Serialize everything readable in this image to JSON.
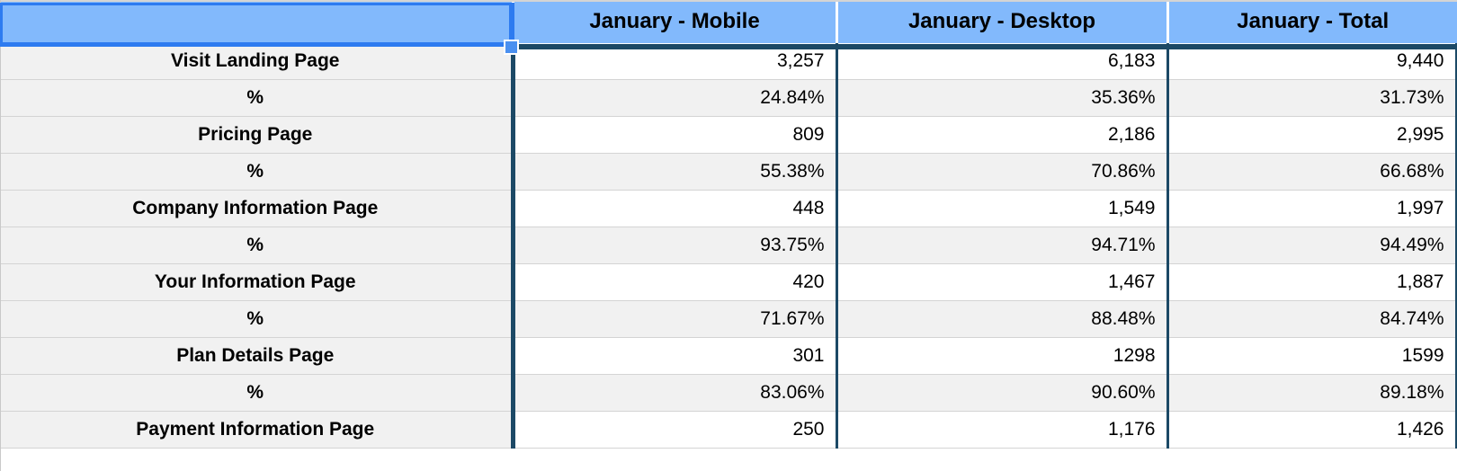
{
  "table": {
    "columns": [
      {
        "key": "label",
        "header": ""
      },
      {
        "key": "mobile",
        "header": "January - Mobile"
      },
      {
        "key": "desktop",
        "header": "January - Desktop"
      },
      {
        "key": "total",
        "header": "January - Total"
      }
    ],
    "rows": [
      {
        "label": "Visit Landing Page",
        "mobile": "3,257",
        "desktop": "6,183",
        "total": "9,440"
      },
      {
        "label": "%",
        "mobile": "24.84%",
        "desktop": "35.36%",
        "total": "31.73%"
      },
      {
        "label": "Pricing Page",
        "mobile": "809",
        "desktop": "2,186",
        "total": "2,995"
      },
      {
        "label": "%",
        "mobile": "55.38%",
        "desktop": "70.86%",
        "total": "66.68%"
      },
      {
        "label": "Company Information Page",
        "mobile": "448",
        "desktop": "1,549",
        "total": "1,997"
      },
      {
        "label": "%",
        "mobile": "93.75%",
        "desktop": "94.71%",
        "total": "94.49%"
      },
      {
        "label": "Your Information Page",
        "mobile": "420",
        "desktop": "1,467",
        "total": "1,887"
      },
      {
        "label": "%",
        "mobile": "71.67%",
        "desktop": "88.48%",
        "total": "84.74%"
      },
      {
        "label": "Plan Details Page",
        "mobile": "301",
        "desktop": "1298",
        "total": "1599"
      },
      {
        "label": "%",
        "mobile": "83.06%",
        "desktop": "90.60%",
        "total": "89.18%"
      },
      {
        "label": "Payment Information Page",
        "mobile": "250",
        "desktop": "1,176",
        "total": "1,426"
      }
    ]
  },
  "selection": {
    "header_fill": "#82b9fc",
    "selection_border": "#1c4966",
    "handle_fill": "#4a90f0",
    "row_stripe": "#f1f1f1"
  }
}
